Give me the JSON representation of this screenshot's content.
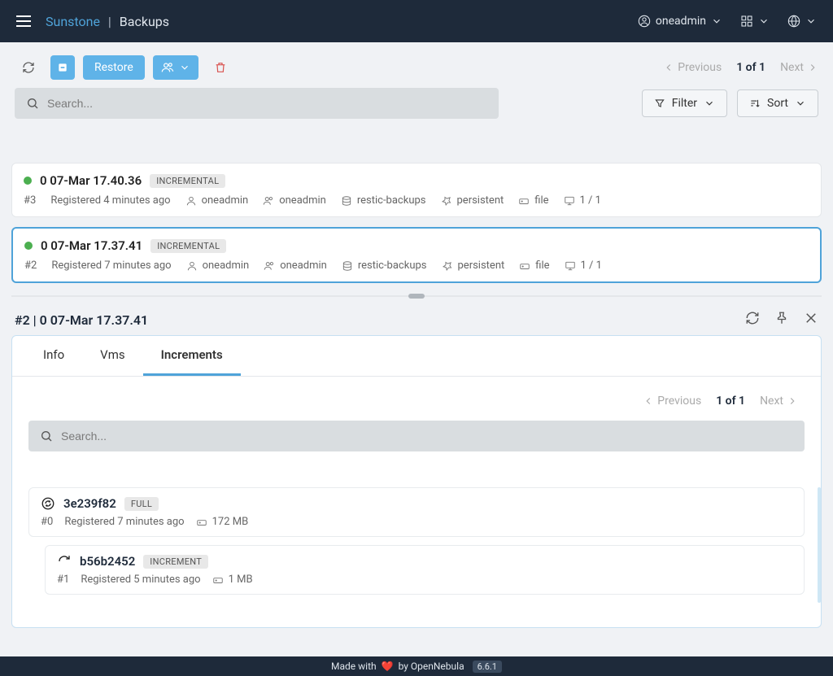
{
  "brand": {
    "name": "Sunstone",
    "page": "Backups",
    "sep": "|"
  },
  "header": {
    "user": "oneadmin"
  },
  "toolbar": {
    "restore": "Restore"
  },
  "pager": {
    "prev": "Previous",
    "next": "Next",
    "count": "1 of 1"
  },
  "search": {
    "placeholder": "Search..."
  },
  "filter": {
    "label": "Filter"
  },
  "sort": {
    "label": "Sort"
  },
  "backups": [
    {
      "id": "#3",
      "title": "0 07-Mar 17.40.36",
      "badge": "INCREMENTAL",
      "registered": "Registered 4 minutes ago",
      "owner": "oneadmin",
      "group": "oneadmin",
      "datastore": "restic-backups",
      "persist": "persistent",
      "type": "file",
      "running": "1 / 1"
    },
    {
      "id": "#2",
      "title": "0 07-Mar 17.37.41",
      "badge": "INCREMENTAL",
      "registered": "Registered 7 minutes ago",
      "owner": "oneadmin",
      "group": "oneadmin",
      "datastore": "restic-backups",
      "persist": "persistent",
      "type": "file",
      "running": "1 / 1"
    }
  ],
  "detail": {
    "title": "#2 | 0 07-Mar 17.37.41"
  },
  "tabs": {
    "info": "Info",
    "vms": "Vms",
    "increments": "Increments"
  },
  "inner_pager": {
    "prev": "Previous",
    "next": "Next",
    "count": "1 of 1"
  },
  "increments": [
    {
      "id": "#0",
      "hash": "3e239f82",
      "badge": "FULL",
      "registered": "Registered 7 minutes ago",
      "size": "172 MB"
    },
    {
      "id": "#1",
      "hash": "b56b2452",
      "badge": "INCREMENT",
      "registered": "Registered 5 minutes ago",
      "size": "1 MB"
    }
  ],
  "footer": {
    "made": "Made with",
    "by": "by OpenNebula",
    "version": "6.6.1"
  }
}
